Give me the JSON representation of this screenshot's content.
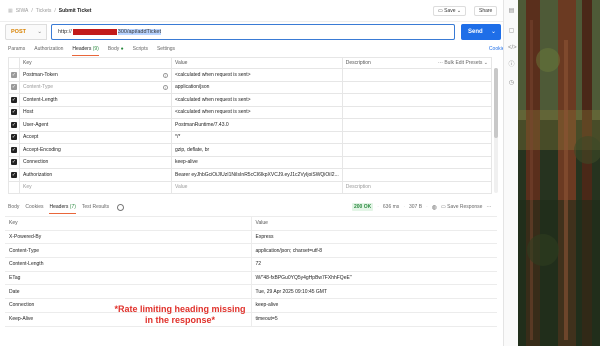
{
  "breadcrumb": {
    "items": [
      "SIWA",
      "Tickets",
      "Submit Ticket"
    ],
    "separator": "/"
  },
  "toolbar": {
    "save_label": "Save",
    "share_label": "Share"
  },
  "request": {
    "method": "POST",
    "url_prefix": "http://",
    "url_suffix": "300/api/addTicket",
    "send_label": "Send"
  },
  "request_tabs": {
    "params": "Params",
    "authorization": "Authorization",
    "headers": "Headers",
    "headers_count": "(9)",
    "body": "Body",
    "scripts": "Scripts",
    "settings": "Settings",
    "cookies": "Cookies"
  },
  "headers_table": {
    "columns": [
      "Key",
      "Value",
      "Description"
    ],
    "bulk_edit": "Bulk Edit",
    "presets": "Presets",
    "rows": [
      {
        "key": "Postman-Token",
        "value": "<calculated when request is sent>",
        "state": "auto"
      },
      {
        "key": "Content-Type",
        "value": "application/json",
        "state": "auto-muted"
      },
      {
        "key": "Content-Length",
        "value": "<calculated when request is sent>",
        "state": "on"
      },
      {
        "key": "Host",
        "value": "<calculated when request is sent>",
        "state": "on"
      },
      {
        "key": "User-Agent",
        "value": "PostmanRuntime/7.43.0",
        "state": "on"
      },
      {
        "key": "Accept",
        "value": "*/*",
        "state": "on"
      },
      {
        "key": "Accept-Encoding",
        "value": "gzip, deflate, br",
        "state": "on"
      },
      {
        "key": "Connection",
        "value": "keep-alive",
        "state": "on"
      },
      {
        "key": "Authorization",
        "value": "Bearer eyJhbGciOiJIUzI1NiIsInR5cCI6IkpXVCJ9.eyJ1c2VyIjoiSWQiOiI2...",
        "state": "on"
      }
    ],
    "placeholder": {
      "key": "Key",
      "value": "Value",
      "description": "Description"
    }
  },
  "response_tabs": {
    "body": "Body",
    "cookies": "Cookies",
    "headers": "Headers",
    "headers_count": "(7)",
    "test_results": "Test Results"
  },
  "response_stats": {
    "status": "200 OK",
    "time": "636 ms",
    "size": "307 B",
    "save_response": "Save Response"
  },
  "response_headers": {
    "columns": [
      "Key",
      "Value"
    ],
    "rows": [
      {
        "key": "X-Powered-By",
        "value": "Express"
      },
      {
        "key": "Content-Type",
        "value": "application/json; charset=utf-8"
      },
      {
        "key": "Content-Length",
        "value": "72"
      },
      {
        "key": "ETag",
        "value": "W/\"48-fxBPGu0YQ5y4gHpBw7FXhhFQeE\""
      },
      {
        "key": "Date",
        "value": "Tue, 29 Apr 2025 09:10:45 GMT"
      },
      {
        "key": "Connection",
        "value": "keep-alive"
      },
      {
        "key": "Keep-Alive",
        "value": "timeout=5"
      }
    ]
  },
  "annotation": {
    "line1": "*Rate limiting heading missing",
    "line2": "in the response*",
    "color": "#e0312b"
  },
  "colors": {
    "accent": "#1e6ee8",
    "method": "#d98200",
    "tab_underline": "#e9663a",
    "status_ok": "#2a8a3f",
    "redaction": "#c21a1a"
  }
}
